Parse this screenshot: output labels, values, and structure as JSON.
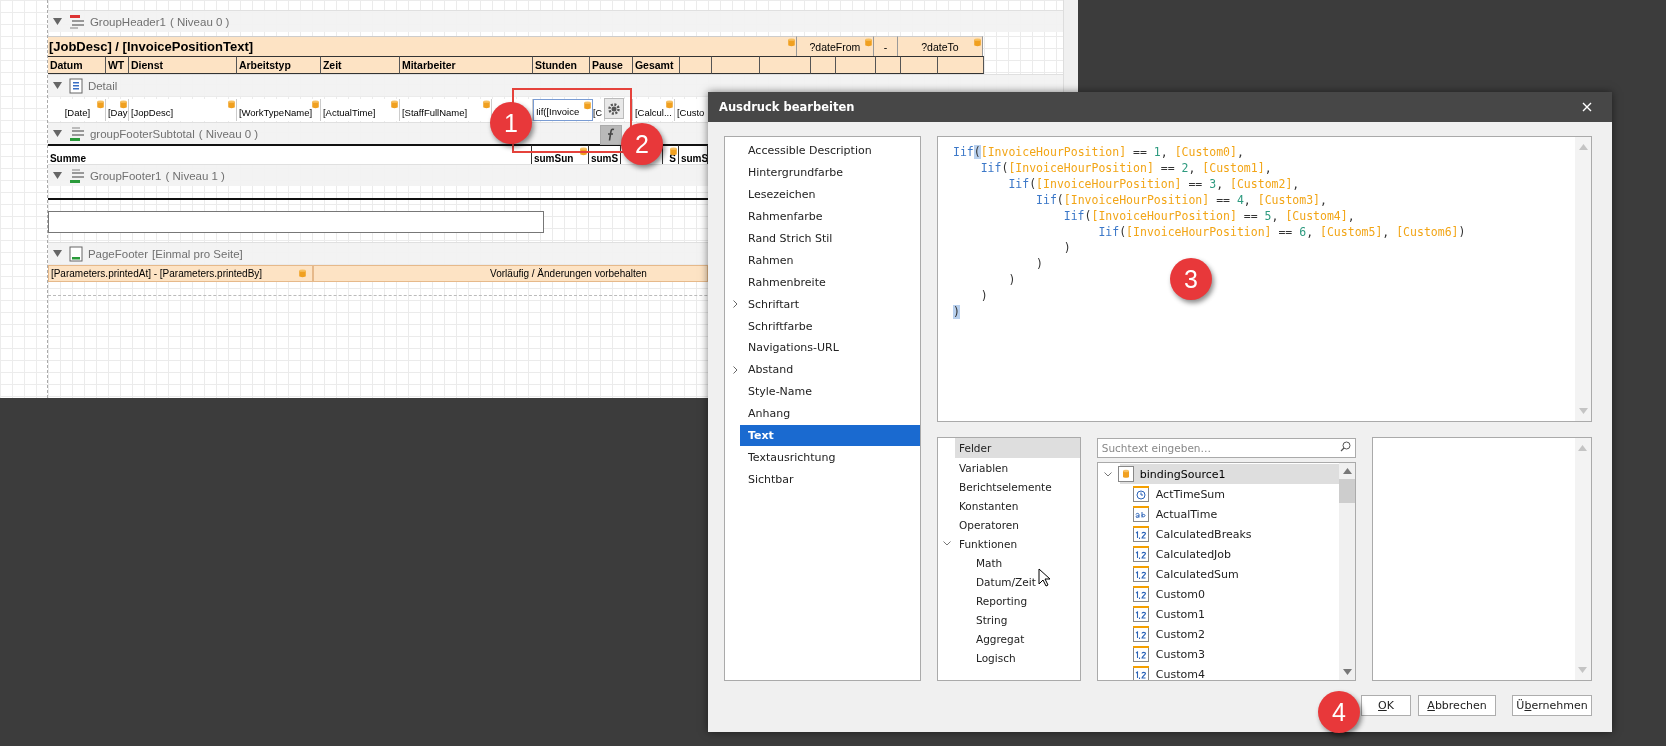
{
  "report": {
    "bands": [
      {
        "kind": "group-header",
        "label": "GroupHeader1",
        "suffix": "( Niveau 0 )",
        "lines": [
          {
            "kind": "title",
            "items": [
              {
                "text": "[JobDesc] / [InvoicePositionText]",
                "bound": true
              },
              {
                "text": "?dateFrom",
                "bound": true
              },
              {
                "text": "-",
                "bound": false
              },
              {
                "text": "?dateTo",
                "bound": true
              }
            ]
          },
          {
            "kind": "columns",
            "items": [
              {
                "text": "Datum"
              },
              {
                "text": "WT"
              },
              {
                "text": "Dienst"
              },
              {
                "text": "Arbeitstyp"
              },
              {
                "text": "Zeit"
              },
              {
                "text": "Mitarbeiter"
              },
              {
                "text": "Stunden"
              },
              {
                "text": "Pause"
              },
              {
                "text": "Gesamt"
              }
            ]
          }
        ]
      },
      {
        "kind": "detail",
        "label": "Detail",
        "lines": [
          {
            "kind": "fields",
            "items": [
              {
                "text": "[Date]",
                "bound": true,
                "selected": false
              },
              {
                "text": "[Day",
                "bound": true,
                "selected": false
              },
              {
                "text": "[JopDesc]",
                "bound": true,
                "selected": false
              },
              {
                "text": "[WorkTypeName]",
                "bound": true,
                "selected": false
              },
              {
                "text": "[ActualTime]",
                "bound": true,
                "selected": false
              },
              {
                "text": "[StaffFullName]",
                "bound": true,
                "selected": false
              },
              {
                "text": "Iif([Invoice",
                "bound": true,
                "selected": true
              },
              {
                "text": "[C",
                "bound": false,
                "selected": false
              },
              {
                "text": "[Calcul...",
                "bound": true,
                "selected": false
              },
              {
                "text": "[Custo",
                "bound": false,
                "selected": false
              }
            ]
          }
        ]
      },
      {
        "kind": "group-footer",
        "label": "groupFooterSubtotal",
        "suffix": "( Niveau 0 )",
        "lines": [
          {
            "kind": "sum",
            "items": [
              {
                "text": "Summe",
                "bound": false
              },
              {
                "text": "sumSun",
                "bound": true
              },
              {
                "text": "sumS",
                "bound": false
              },
              {
                "text": "S",
                "bound": true
              },
              {
                "text": "sumS",
                "bound": false
              }
            ]
          }
        ]
      },
      {
        "kind": "group-footer",
        "label": "GroupFooter1",
        "suffix": "( Niveau 1 )",
        "lines": [
          {
            "kind": "blank"
          },
          {
            "kind": "rule"
          },
          {
            "kind": "box"
          }
        ]
      },
      {
        "kind": "page-footer",
        "label": "PageFooter",
        "suffix": "[Einmal pro Seite]",
        "lines": [
          {
            "kind": "footer",
            "items": [
              {
                "text": "[Parameters.printedAt] - [Parameters.printedBy]",
                "bound": true
              },
              {
                "text": "Vorläufig / Änderungen vorbehalten",
                "bound": false
              }
            ]
          }
        ]
      }
    ]
  },
  "dialog": {
    "title": "Ausdruck bearbeiten",
    "properties": [
      {
        "label": "Accessible Description",
        "selected": false,
        "expandable": false
      },
      {
        "label": "Hintergrundfarbe",
        "selected": false,
        "expandable": false
      },
      {
        "label": "Lesezeichen",
        "selected": false,
        "expandable": false
      },
      {
        "label": "Rahmenfarbe",
        "selected": false,
        "expandable": false
      },
      {
        "label": "Rand Strich Stil",
        "selected": false,
        "expandable": false
      },
      {
        "label": "Rahmen",
        "selected": false,
        "expandable": false
      },
      {
        "label": "Rahmenbreite",
        "selected": false,
        "expandable": false
      },
      {
        "label": "Schriftart",
        "selected": false,
        "expandable": true
      },
      {
        "label": "Schriftfarbe",
        "selected": false,
        "expandable": false
      },
      {
        "label": "Navigations-URL",
        "selected": false,
        "expandable": false
      },
      {
        "label": "Abstand",
        "selected": false,
        "expandable": true
      },
      {
        "label": "Style-Name",
        "selected": false,
        "expandable": false
      },
      {
        "label": "Anhang",
        "selected": false,
        "expandable": false
      },
      {
        "label": "Text",
        "selected": true,
        "expandable": false
      },
      {
        "label": "Textausrichtung",
        "selected": false,
        "expandable": false
      },
      {
        "label": "Sichtbar",
        "selected": false,
        "expandable": false
      }
    ],
    "code": [
      [
        {
          "kind": "fn",
          "text": "Iif"
        },
        {
          "kind": "match",
          "text": "("
        },
        {
          "kind": "field",
          "text": "[InvoiceHourPosition]"
        },
        {
          "kind": "op",
          "text": " == "
        },
        {
          "kind": "num",
          "text": "1"
        },
        {
          "kind": "op",
          "text": ", "
        },
        {
          "kind": "field",
          "text": "[Custom0]"
        },
        {
          "kind": "op",
          "text": ","
        }
      ],
      [
        {
          "kind": "fn",
          "text": "    Iif"
        },
        {
          "kind": "op",
          "text": "("
        },
        {
          "kind": "field",
          "text": "[InvoiceHourPosition]"
        },
        {
          "kind": "op",
          "text": " == "
        },
        {
          "kind": "num",
          "text": "2"
        },
        {
          "kind": "op",
          "text": ", "
        },
        {
          "kind": "field",
          "text": "[Custom1]"
        },
        {
          "kind": "op",
          "text": ","
        }
      ],
      [
        {
          "kind": "fn",
          "text": "        Iif"
        },
        {
          "kind": "op",
          "text": "("
        },
        {
          "kind": "field",
          "text": "[InvoiceHourPosition]"
        },
        {
          "kind": "op",
          "text": " == "
        },
        {
          "kind": "num",
          "text": "3"
        },
        {
          "kind": "op",
          "text": ", "
        },
        {
          "kind": "field",
          "text": "[Custom2]"
        },
        {
          "kind": "op",
          "text": ","
        }
      ],
      [
        {
          "kind": "fn",
          "text": "            Iif"
        },
        {
          "kind": "op",
          "text": "("
        },
        {
          "kind": "field",
          "text": "[InvoiceHourPosition]"
        },
        {
          "kind": "op",
          "text": " == "
        },
        {
          "kind": "num",
          "text": "4"
        },
        {
          "kind": "op",
          "text": ", "
        },
        {
          "kind": "field",
          "text": "[Custom3]"
        },
        {
          "kind": "op",
          "text": ","
        }
      ],
      [
        {
          "kind": "fn",
          "text": "                Iif"
        },
        {
          "kind": "op",
          "text": "("
        },
        {
          "kind": "field",
          "text": "[InvoiceHourPosition]"
        },
        {
          "kind": "op",
          "text": " == "
        },
        {
          "kind": "num",
          "text": "5"
        },
        {
          "kind": "op",
          "text": ", "
        },
        {
          "kind": "field",
          "text": "[Custom4]"
        },
        {
          "kind": "op",
          "text": ","
        }
      ],
      [
        {
          "kind": "fn",
          "text": "                     Iif"
        },
        {
          "kind": "op",
          "text": "("
        },
        {
          "kind": "field",
          "text": "[InvoiceHourPosition]"
        },
        {
          "kind": "op",
          "text": " == "
        },
        {
          "kind": "num",
          "text": "6"
        },
        {
          "kind": "op",
          "text": ", "
        },
        {
          "kind": "field",
          "text": "[Custom5]"
        },
        {
          "kind": "op",
          "text": ", "
        },
        {
          "kind": "field",
          "text": "[Custom6]"
        },
        {
          "kind": "op",
          "text": ")"
        }
      ],
      [
        {
          "kind": "op",
          "text": "                )"
        }
      ],
      [
        {
          "kind": "op",
          "text": "            )"
        }
      ],
      [
        {
          "kind": "op",
          "text": "        )"
        }
      ],
      [
        {
          "kind": "op",
          "text": "    )"
        }
      ],
      [
        {
          "kind": "match",
          "text": ")"
        }
      ]
    ],
    "categories": [
      {
        "label": "Felder",
        "selected": true,
        "expanded": false
      },
      {
        "label": "Variablen",
        "selected": false,
        "expanded": false
      },
      {
        "label": "Berichtselemente",
        "selected": false,
        "expanded": false
      },
      {
        "label": "Konstanten",
        "selected": false,
        "expanded": false
      },
      {
        "label": "Operatoren",
        "selected": false,
        "expanded": false
      },
      {
        "label": "Funktionen",
        "selected": false,
        "expanded": true,
        "children": [
          {
            "label": "Math"
          },
          {
            "label": "Datum/Zeit"
          },
          {
            "label": "Reporting"
          },
          {
            "label": "String"
          },
          {
            "label": "Aggregat"
          },
          {
            "label": "Logisch"
          }
        ]
      }
    ],
    "search": {
      "placeholder": "Suchtext eingeben…"
    },
    "tree": {
      "label": "bindingSource1",
      "expanded": true,
      "selected": true,
      "children": [
        {
          "label": "ActTimeSum",
          "kind": "time"
        },
        {
          "label": "ActualTime",
          "kind": "text"
        },
        {
          "label": "CalculatedBreaks",
          "kind": "number"
        },
        {
          "label": "CalculatedJob",
          "kind": "number"
        },
        {
          "label": "CalculatedSum",
          "kind": "number"
        },
        {
          "label": "Custom0",
          "kind": "number"
        },
        {
          "label": "Custom1",
          "kind": "number"
        },
        {
          "label": "Custom2",
          "kind": "number"
        },
        {
          "label": "Custom3",
          "kind": "number"
        },
        {
          "label": "Custom4",
          "kind": "number"
        }
      ]
    },
    "buttons": [
      {
        "key": "O",
        "rest": "K"
      },
      {
        "key": "A",
        "rest": "bbrechen"
      },
      {
        "lead": "Ü",
        "key": "b",
        "rest": "ernehmen"
      }
    ]
  },
  "callouts": [
    {
      "text": "1"
    },
    {
      "text": "2"
    },
    {
      "text": "3"
    },
    {
      "text": "4"
    }
  ]
}
